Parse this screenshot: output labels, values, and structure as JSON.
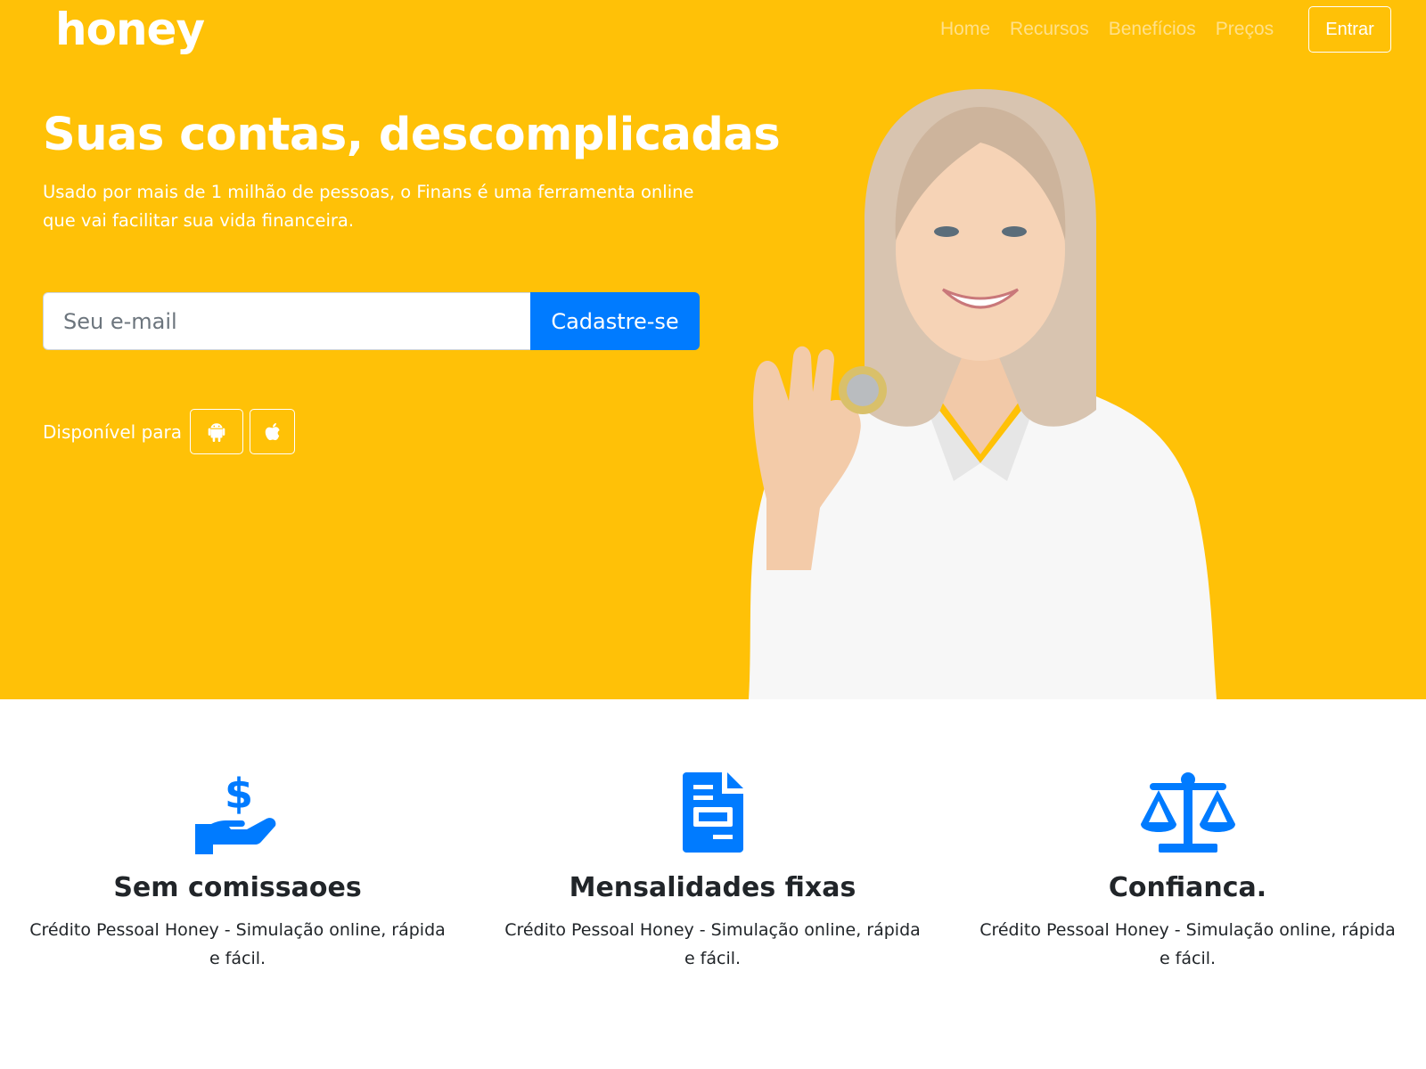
{
  "nav": {
    "logo": "honey",
    "links": [
      {
        "label": "Home"
      },
      {
        "label": "Recursos"
      },
      {
        "label": "Benefícios"
      },
      {
        "label": "Preços"
      }
    ],
    "login_label": "Entrar"
  },
  "hero": {
    "title": "Suas contas, descomplicadas",
    "subtitle": "Usado por mais de 1 milhão de pessoas, o Finans é uma ferramenta online que vai facilitar sua vida financeira.",
    "email_placeholder": "Seu e-mail",
    "email_value": "",
    "signup_label": "Cadastre-se",
    "available_label": "Disponível para",
    "stores": [
      {
        "icon": "android-icon"
      },
      {
        "icon": "apple-icon"
      }
    ]
  },
  "features": [
    {
      "icon": "hand-dollar-icon",
      "title": "Sem comissaoes",
      "text": "Crédito Pessoal Honey - Simulação online, rápida e fácil."
    },
    {
      "icon": "document-icon",
      "title": "Mensalidades fixas",
      "text": "Crédito Pessoal Honey - Simulação online, rápida e fácil."
    },
    {
      "icon": "balance-scale-icon",
      "title": "Confianca.",
      "text": "Crédito Pessoal Honey - Simulação online, rápida e fácil."
    }
  ],
  "colors": {
    "brand_yellow": "#ffc107",
    "primary_blue": "#007bff",
    "text_dark": "#212529"
  }
}
